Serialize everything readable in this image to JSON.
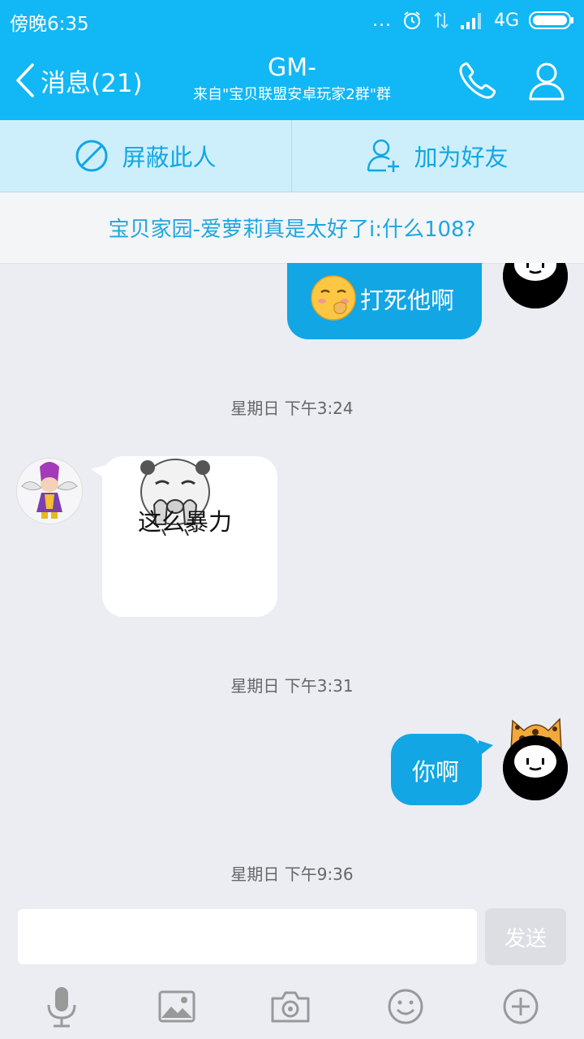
{
  "status": {
    "time": "傍晚6:35",
    "dots": "...",
    "network": "4G"
  },
  "header": {
    "back_label": "消息(21)",
    "title": "GM-",
    "subtitle": "来自\"宝贝联盟安卓玩家2群\"群"
  },
  "actions": {
    "block_label": "屏蔽此人",
    "add_friend_label": "加为好友"
  },
  "notice": "宝贝家园-爱萝莉真是太好了i:什么108?",
  "messages": [
    {
      "sender": "me",
      "text": "打死他啊",
      "emoji": "hand-over-mouth-emoji"
    },
    {
      "type": "time",
      "text": "星期日 下午3:24"
    },
    {
      "sender": "other",
      "text": "这么暴力",
      "sticker": "panda-face-sticker"
    },
    {
      "type": "time",
      "text": "星期日 下午3:31"
    },
    {
      "sender": "me",
      "text": "你啊"
    },
    {
      "type": "time",
      "text": "星期日 下午9:36"
    }
  ],
  "input": {
    "value": "",
    "send_label": "发送"
  },
  "toolbar": [
    "mic-icon",
    "image-icon",
    "camera-icon",
    "smiley-icon",
    "plus-icon"
  ],
  "colors": {
    "brand": "#12b7f5",
    "bubble_me": "#12a6e4",
    "chat_bg": "#ebedf2",
    "action_bg": "#cdeffc",
    "notice_text": "#1ea6e0"
  }
}
